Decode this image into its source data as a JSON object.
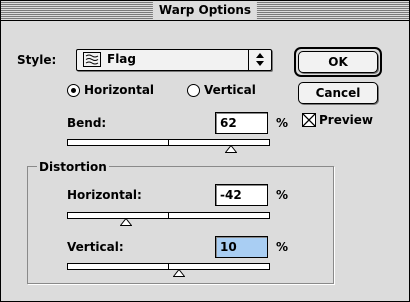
{
  "window": {
    "title": "Warp Options"
  },
  "style": {
    "label": "Style:",
    "value": "Flag",
    "icon": "flag-icon"
  },
  "orientation": {
    "horizontal_label": "Horizontal",
    "vertical_label": "Vertical",
    "selected": "Horizontal"
  },
  "bend": {
    "label": "Bend:",
    "value": "62",
    "unit": "%",
    "level": 62
  },
  "distortion": {
    "title": "Distortion",
    "horizontal": {
      "label": "Horizontal:",
      "value": "-42",
      "unit": "%",
      "level": -42
    },
    "vertical": {
      "label": "Vertical:",
      "value": "10",
      "unit": "%",
      "level": 10
    }
  },
  "buttons": {
    "ok": "OK",
    "cancel": "Cancel"
  },
  "preview": {
    "label": "Preview",
    "checked": true
  },
  "colors": {
    "dialog_bg": "#dcdcdc",
    "field_focus": "#a9cef3"
  }
}
